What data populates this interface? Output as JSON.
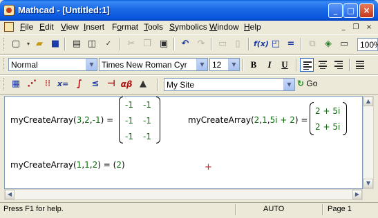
{
  "window": {
    "title": "Mathcad - [Untitled:1]"
  },
  "titlebar_buttons": {
    "minimize": "_",
    "maximize": "□",
    "close": "×"
  },
  "menu": {
    "items": [
      {
        "ul": "F",
        "rest": "ile"
      },
      {
        "ul": "E",
        "rest": "dit"
      },
      {
        "ul": "V",
        "rest": "iew"
      },
      {
        "ul": "I",
        "rest": "nsert"
      },
      {
        "pre": "F",
        "ul": "o",
        "rest": "rmat"
      },
      {
        "ul": "T",
        "rest": "ools"
      },
      {
        "ul": "S",
        "rest": "ymbolics"
      },
      {
        "ul": "W",
        "rest": "indow"
      },
      {
        "ul": "H",
        "rest": "elp"
      }
    ],
    "mdi": {
      "minimize": "_",
      "restore": "❐",
      "close": "×"
    }
  },
  "standard_toolbar": {
    "zoom": "100%",
    "icons": [
      "new-icon",
      "open-icon",
      "save-icon",
      "print-icon",
      "print-preview-icon",
      "spell-check-icon",
      "cut-icon",
      "copy-icon",
      "paste-icon",
      "undo-icon",
      "redo-icon",
      "align-across-icon",
      "align-down-icon",
      "insert-function-icon",
      "insert-unit-icon",
      "calculate-icon",
      "insert-component-icon",
      "resources-icon",
      "show-hide-icon"
    ]
  },
  "formatting_toolbar": {
    "style": "Normal",
    "font": "Times New Roman Cyr",
    "size": "12",
    "bold": "B",
    "italic": "I",
    "underline": "U"
  },
  "math_toolbar": {
    "calculator_glyph": "x=",
    "greek_glyph": "αβ",
    "site": "My Site",
    "go_label": "Go",
    "go_icon": "↻"
  },
  "worksheet": {
    "expr1": {
      "fn": "myCreateArray",
      "args": [
        "3",
        "2",
        "-1"
      ],
      "matrix": [
        [
          "-1",
          "-1"
        ],
        [
          "-1",
          "-1"
        ],
        [
          "-1",
          "-1"
        ]
      ]
    },
    "expr2": {
      "fn": "myCreateArray",
      "args": [
        "2",
        "1",
        "5i + 2"
      ],
      "matrix": [
        [
          "2 + 5i"
        ],
        [
          "2 + 5i"
        ]
      ]
    },
    "expr3": {
      "fn": "myCreateArray",
      "args": [
        "1",
        "1",
        "2"
      ],
      "result": "2"
    },
    "comma": ",",
    "equals": "=",
    "open_paren": "(",
    "close_paren": ")",
    "cursor": "+"
  },
  "statusbar": {
    "help": "Press F1 for help.",
    "mode": "AUTO",
    "page": "Page 1"
  },
  "colors": {
    "titlebar": "#0855dd",
    "numbers": "#0a6b0a",
    "cursor": "#d02020",
    "chrome": "#ece9d8"
  }
}
